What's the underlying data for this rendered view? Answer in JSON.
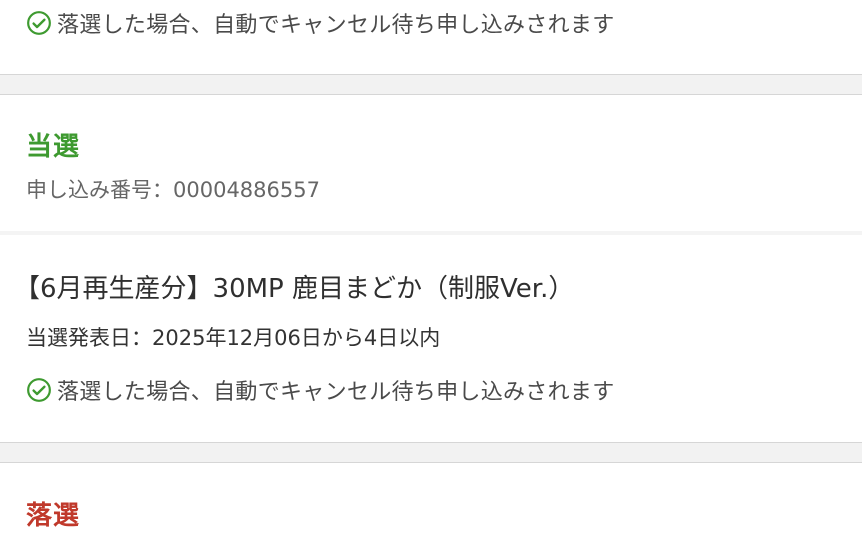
{
  "colors": {
    "check": "#3e9a30",
    "win": "#3e9a30",
    "lose": "#c0392b"
  },
  "top_item": {
    "check_icon": "check-circle-icon",
    "cancel_wait_note": "落選した場合、自動でキャンセル待ち申し込みされます"
  },
  "win_section": {
    "status": "当選",
    "application_number": "申し込み番号：00004886557",
    "product": {
      "title": "【6月再生産分】30MP 鹿目まどか（制服Ver.）",
      "announcement": "当選発表日：2025年12月06日から4日以内",
      "check_icon": "check-circle-icon",
      "cancel_wait_note": "落選した場合、自動でキャンセル待ち申し込みされます"
    }
  },
  "lose_section": {
    "status": "落選"
  }
}
